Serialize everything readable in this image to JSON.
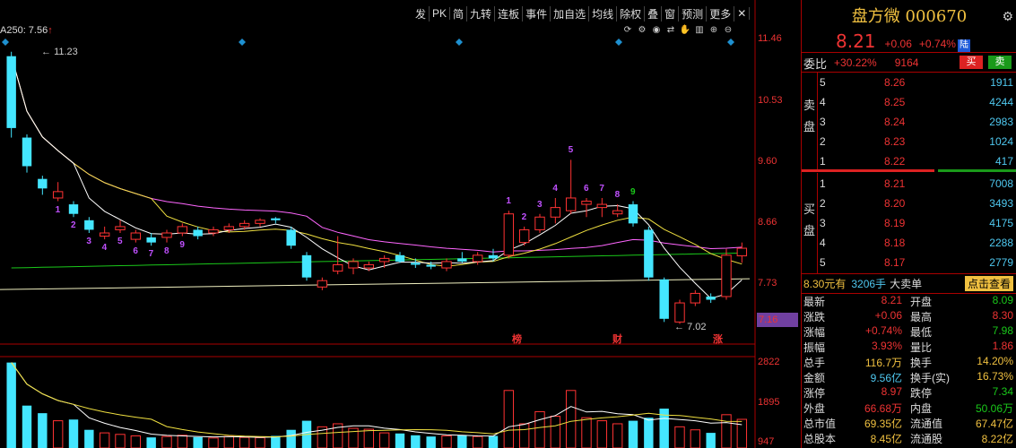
{
  "toolbar": {
    "items": [
      "发",
      "PK",
      "简",
      "九转",
      "连板",
      "事件",
      "加自选",
      "均线",
      "除权",
      "叠",
      "窗",
      "预测",
      "更多"
    ],
    "close_label": "✕"
  },
  "ma_label": {
    "text": "A250: 7.56",
    "arrow": "↑"
  },
  "price_axis": {
    "labels": [
      "11.46",
      "10.53",
      "9.60",
      "8.66",
      "7.73",
      "7.16"
    ]
  },
  "volume_axis": {
    "labels": [
      "2822",
      "1895",
      "947"
    ]
  },
  "high_label": "11.23",
  "low_label": "7.02",
  "events": [
    {
      "label": "榜"
    },
    {
      "label": "财"
    },
    {
      "label": "涨"
    }
  ],
  "markers": [
    {
      "text": "1",
      "color": "#c050ff"
    },
    {
      "text": "2",
      "color": "#c050ff"
    },
    {
      "text": "3",
      "color": "#c050ff"
    },
    {
      "text": "4",
      "color": "#c050ff"
    },
    {
      "text": "5",
      "color": "#c050ff"
    },
    {
      "text": "6",
      "color": "#c050ff"
    },
    {
      "text": "7",
      "color": "#c050ff"
    },
    {
      "text": "8",
      "color": "#c050ff"
    },
    {
      "text": "9",
      "color": "#c050ff"
    },
    {
      "text": "1",
      "color": "#c050ff"
    },
    {
      "text": "2",
      "color": "#c050ff"
    },
    {
      "text": "3",
      "color": "#c050ff"
    },
    {
      "text": "4",
      "color": "#c050ff"
    },
    {
      "text": "5",
      "color": "#c050ff"
    },
    {
      "text": "6",
      "color": "#c050ff"
    },
    {
      "text": "7",
      "color": "#c050ff"
    },
    {
      "text": "8",
      "color": "#c050ff"
    },
    {
      "text": "9",
      "color": "#1ac81a"
    }
  ],
  "chart_data": {
    "type": "candlestick",
    "ylim": [
      7.02,
      11.46
    ],
    "candles": [
      {
        "o": 10.1,
        "h": 11.3,
        "l": 9.95,
        "c": 11.23,
        "up": false
      },
      {
        "o": 9.95,
        "h": 10.0,
        "l": 9.4,
        "c": 9.5,
        "up": false
      },
      {
        "o": 9.3,
        "h": 9.35,
        "l": 9.05,
        "c": 9.15,
        "up": false
      },
      {
        "o": 9.0,
        "h": 9.25,
        "l": 8.95,
        "c": 9.1,
        "up": true
      },
      {
        "o": 8.9,
        "h": 8.95,
        "l": 8.7,
        "c": 8.75,
        "up": false
      },
      {
        "o": 8.65,
        "h": 8.7,
        "l": 8.45,
        "c": 8.5,
        "up": false
      },
      {
        "o": 8.4,
        "h": 8.55,
        "l": 8.35,
        "c": 8.45,
        "up": true
      },
      {
        "o": 8.55,
        "h": 8.65,
        "l": 8.45,
        "c": 8.5,
        "up": true
      },
      {
        "o": 8.35,
        "h": 8.5,
        "l": 8.3,
        "c": 8.45,
        "up": true
      },
      {
        "o": 8.38,
        "h": 8.45,
        "l": 8.25,
        "c": 8.3,
        "up": false
      },
      {
        "o": 8.38,
        "h": 8.5,
        "l": 8.3,
        "c": 8.45,
        "up": true
      },
      {
        "o": 8.45,
        "h": 8.6,
        "l": 8.4,
        "c": 8.55,
        "up": true
      },
      {
        "o": 8.5,
        "h": 8.55,
        "l": 8.35,
        "c": 8.4,
        "up": false
      },
      {
        "o": 8.45,
        "h": 8.55,
        "l": 8.4,
        "c": 8.5,
        "up": true
      },
      {
        "o": 8.5,
        "h": 8.6,
        "l": 8.45,
        "c": 8.55,
        "up": true
      },
      {
        "o": 8.55,
        "h": 8.65,
        "l": 8.5,
        "c": 8.6,
        "up": true
      },
      {
        "o": 8.6,
        "h": 8.68,
        "l": 8.55,
        "c": 8.65,
        "up": true
      },
      {
        "o": 8.68,
        "h": 8.7,
        "l": 8.6,
        "c": 8.65,
        "up": false
      },
      {
        "o": 8.5,
        "h": 8.55,
        "l": 8.2,
        "c": 8.25,
        "up": false
      },
      {
        "o": 8.1,
        "h": 8.15,
        "l": 7.7,
        "c": 7.75,
        "up": false
      },
      {
        "o": 7.6,
        "h": 7.75,
        "l": 7.55,
        "c": 7.7,
        "up": true
      },
      {
        "o": 7.85,
        "h": 8.4,
        "l": 7.8,
        "c": 7.95,
        "up": true
      },
      {
        "o": 7.9,
        "h": 8.05,
        "l": 7.8,
        "c": 8.0,
        "up": true
      },
      {
        "o": 7.9,
        "h": 8.0,
        "l": 7.85,
        "c": 7.95,
        "up": true
      },
      {
        "o": 8.0,
        "h": 8.1,
        "l": 7.9,
        "c": 8.05,
        "up": true
      },
      {
        "o": 8.1,
        "h": 8.15,
        "l": 7.98,
        "c": 8.0,
        "up": false
      },
      {
        "o": 7.98,
        "h": 8.05,
        "l": 7.9,
        "c": 7.95,
        "up": false
      },
      {
        "o": 7.95,
        "h": 8.0,
        "l": 7.88,
        "c": 7.92,
        "up": false
      },
      {
        "o": 7.9,
        "h": 8.05,
        "l": 7.85,
        "c": 8.0,
        "up": true
      },
      {
        "o": 8.05,
        "h": 8.15,
        "l": 7.98,
        "c": 8.0,
        "up": false
      },
      {
        "o": 8.0,
        "h": 8.15,
        "l": 7.95,
        "c": 8.1,
        "up": true
      },
      {
        "o": 8.1,
        "h": 8.2,
        "l": 8.0,
        "c": 8.05,
        "up": false
      },
      {
        "o": 8.1,
        "h": 8.8,
        "l": 8.05,
        "c": 8.75,
        "up": true
      },
      {
        "o": 8.3,
        "h": 8.55,
        "l": 8.25,
        "c": 8.5,
        "up": true
      },
      {
        "o": 8.5,
        "h": 8.75,
        "l": 8.45,
        "c": 8.7,
        "up": true
      },
      {
        "o": 8.7,
        "h": 9.0,
        "l": 8.6,
        "c": 8.85,
        "up": true
      },
      {
        "o": 8.8,
        "h": 9.6,
        "l": 8.75,
        "c": 9.0,
        "up": true
      },
      {
        "o": 8.9,
        "h": 9.0,
        "l": 8.7,
        "c": 8.95,
        "up": true
      },
      {
        "o": 8.9,
        "h": 9.0,
        "l": 8.7,
        "c": 8.85,
        "up": true
      },
      {
        "o": 8.8,
        "h": 8.9,
        "l": 8.7,
        "c": 8.75,
        "up": true
      },
      {
        "o": 8.9,
        "h": 8.95,
        "l": 8.55,
        "c": 8.6,
        "up": false
      },
      {
        "o": 8.5,
        "h": 8.55,
        "l": 7.7,
        "c": 7.75,
        "up": false
      },
      {
        "o": 7.72,
        "h": 7.75,
        "l": 7.05,
        "c": 7.1,
        "up": false
      },
      {
        "o": 7.05,
        "h": 7.4,
        "l": 7.02,
        "c": 7.35,
        "up": true
      },
      {
        "o": 7.35,
        "h": 7.55,
        "l": 7.3,
        "c": 7.5,
        "up": true
      },
      {
        "o": 7.45,
        "h": 7.5,
        "l": 7.35,
        "c": 7.4,
        "up": false
      },
      {
        "o": 7.45,
        "h": 8.2,
        "l": 7.4,
        "c": 8.1,
        "up": true
      },
      {
        "o": 8.09,
        "h": 8.3,
        "l": 7.98,
        "c": 8.21,
        "up": true
      }
    ],
    "volumes": [
      2822,
      1400,
      1150,
      900,
      940,
      600,
      500,
      450,
      400,
      350,
      380,
      420,
      360,
      330,
      380,
      350,
      340,
      400,
      600,
      900,
      700,
      800,
      650,
      620,
      500,
      480,
      420,
      380,
      400,
      420,
      380,
      400,
      1900,
      800,
      1200,
      1050,
      1900,
      1000,
      900,
      800,
      900,
      1000,
      1300,
      700,
      600,
      500,
      1100,
      947
    ]
  },
  "panel": {
    "stock_name": "盘方微",
    "stock_code": "000670",
    "price": "8.21",
    "change": "+0.06",
    "change_pct": "+0.74%",
    "board_tag": "陆",
    "weibi_label": "委比",
    "weibi_pct": "+30.22%",
    "weibi_vol": "9164",
    "buy_btn": "买",
    "sell_btn": "卖",
    "sell_side_label": [
      "卖",
      "盘"
    ],
    "buy_side_label": [
      "买",
      "盘"
    ],
    "asks": [
      {
        "idx": "5",
        "price": "8.26",
        "vol": "1911"
      },
      {
        "idx": "4",
        "price": "8.25",
        "vol": "4244"
      },
      {
        "idx": "3",
        "price": "8.24",
        "vol": "2983"
      },
      {
        "idx": "2",
        "price": "8.23",
        "vol": "1024"
      },
      {
        "idx": "1",
        "price": "8.22",
        "vol": "417"
      }
    ],
    "bids": [
      {
        "idx": "1",
        "price": "8.21",
        "vol": "7008"
      },
      {
        "idx": "2",
        "price": "8.20",
        "vol": "3493"
      },
      {
        "idx": "3",
        "price": "8.19",
        "vol": "4175"
      },
      {
        "idx": "4",
        "price": "8.18",
        "vol": "2288"
      },
      {
        "idx": "5",
        "price": "8.17",
        "vol": "2779"
      }
    ],
    "summary": {
      "a": "8.30元有",
      "b": "3206手",
      "c": "大卖单",
      "d": "点击查看"
    },
    "stats": [
      {
        "l1": "最新",
        "v1": "8.21",
        "c1": "red",
        "l2": "开盘",
        "v2": "8.09",
        "c2": "green"
      },
      {
        "l1": "涨跌",
        "v1": "+0.06",
        "c1": "red",
        "l2": "最高",
        "v2": "8.30",
        "c2": "red"
      },
      {
        "l1": "涨幅",
        "v1": "+0.74%",
        "c1": "red",
        "l2": "最低",
        "v2": "7.98",
        "c2": "green"
      },
      {
        "l1": "振幅",
        "v1": "3.93%",
        "c1": "red",
        "l2": "量比",
        "v2": "1.86",
        "c2": "red"
      },
      {
        "l1": "总手",
        "v1": "116.7万",
        "c1": "yellow",
        "l2": "换手",
        "v2": "14.20%",
        "c2": "yellow"
      },
      {
        "l1": "金额",
        "v1": "9.56亿",
        "c1": "cyan",
        "l2": "换手(实)",
        "v2": "16.73%",
        "c2": "yellow"
      },
      {
        "l1": "涨停",
        "v1": "8.97",
        "c1": "red",
        "l2": "跌停",
        "v2": "7.34",
        "c2": "green"
      },
      {
        "l1": "外盘",
        "v1": "66.68万",
        "c1": "red",
        "l2": "内盘",
        "v2": "50.06万",
        "c2": "green"
      },
      {
        "l1": "总市值",
        "v1": "69.35亿",
        "c1": "yellow",
        "l2": "流通值",
        "v2": "67.47亿",
        "c2": "yellow"
      },
      {
        "l1": "总股本",
        "v1": "8.45亿",
        "c1": "yellow",
        "l2": "流通股",
        "v2": "8.22亿",
        "c2": "yellow"
      }
    ]
  }
}
